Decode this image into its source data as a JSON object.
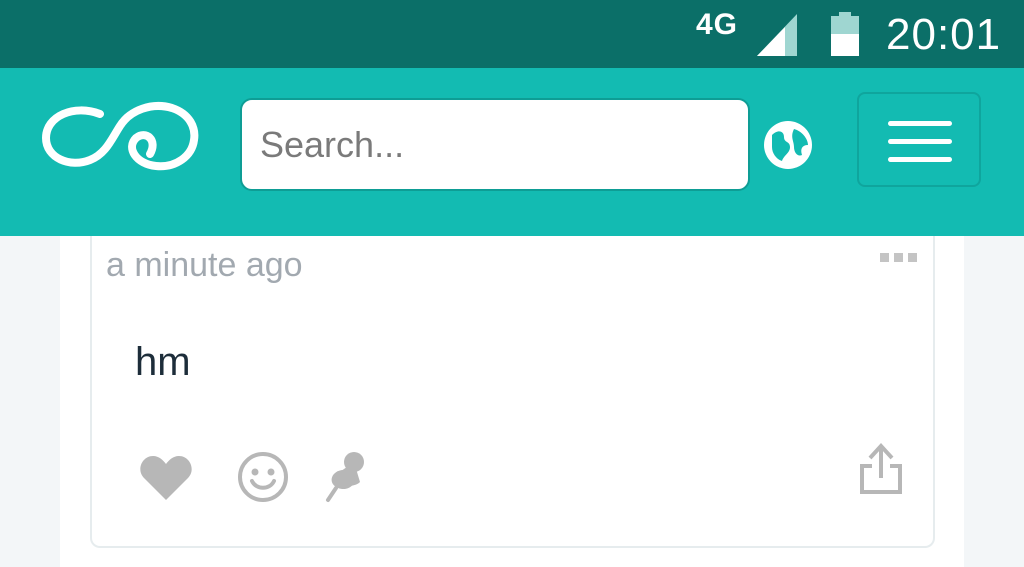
{
  "status_bar": {
    "network": "4G",
    "time": "20:01",
    "icons": [
      "signal-icon",
      "battery-icon"
    ]
  },
  "app_bar": {
    "logo": "infinity-logo",
    "search": {
      "placeholder": "Search...",
      "value": ""
    },
    "globe_icon": "globe-icon",
    "menu_icon": "hamburger-menu-icon"
  },
  "post": {
    "timestamp": "a minute ago",
    "text": "hm",
    "actions": [
      "heart-icon",
      "smiley-icon",
      "pin-icon",
      "share-icon"
    ],
    "more_icon": "more-dots-icon"
  },
  "colors": {
    "status_bar": "#0b6f68",
    "app_bar": "#13bbb2",
    "background": "#f3f6f8",
    "icon_gray": "#b7b7b7"
  }
}
